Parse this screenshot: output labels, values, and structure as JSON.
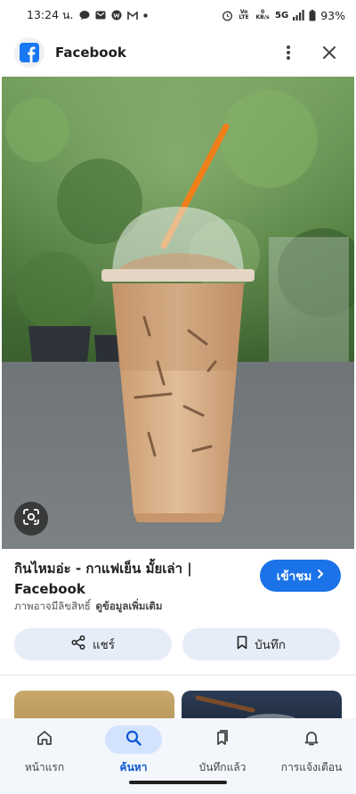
{
  "status_bar": {
    "time": "13:24 น.",
    "network": "5G",
    "battery": "93%",
    "notification_icons": [
      "message-icon",
      "email-icon",
      "word-app-icon",
      "gmail-icon",
      "dot-icon"
    ],
    "right_icons": [
      "alarm-icon",
      "volte-icon",
      "data-speed-icon",
      "signal-icon",
      "battery-icon"
    ],
    "volte_label": "Vo LTE",
    "speed_label": "0 KB/s"
  },
  "header": {
    "app_name": "Facebook",
    "logo_icon": "facebook-icon",
    "menu_icon": "more-vert-icon",
    "close_icon": "close-icon"
  },
  "image": {
    "subject": "iced coffee in plastic cup with orange straw"
  },
  "result": {
    "title": "กินไหมอ่ะ - กาแฟเย็น มั้ยเล่า | Facebook",
    "license_text": "ภาพอาจมีลิขสิทธิ์",
    "more_info": "ดูข้อมูลเพิ่มเติม",
    "visit_label": "เข้าชม"
  },
  "actions": {
    "share_label": "แชร์",
    "save_label": "บันทึก"
  },
  "bottom_nav": {
    "items": [
      {
        "label": "หน้าแรก",
        "icon": "home-icon",
        "active": false
      },
      {
        "label": "ค้นหา",
        "icon": "search-icon",
        "active": true
      },
      {
        "label": "บันทึกแล้ว",
        "icon": "saved-icon",
        "active": false
      },
      {
        "label": "การแจ้งเตือน",
        "icon": "bell-icon",
        "active": false
      }
    ]
  },
  "colors": {
    "accent": "#1a73e8",
    "pill_bg": "#e6edf8",
    "nav_active_bg": "#d3e3fd",
    "facebook_blue": "#1877f2"
  }
}
